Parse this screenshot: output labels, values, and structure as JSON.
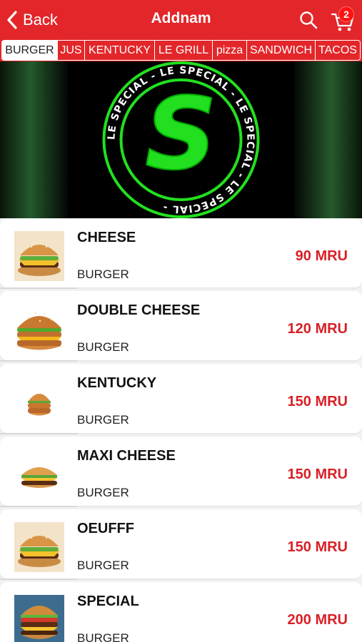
{
  "header": {
    "back_label": "Back",
    "title": "Addnam",
    "cart_count": "2",
    "color": "#e3262a"
  },
  "tabs": [
    {
      "label": "BURGER",
      "active": true
    },
    {
      "label": "JUS",
      "active": false
    },
    {
      "label": "KENTUCKY",
      "active": false
    },
    {
      "label": "LE GRILL",
      "active": false
    },
    {
      "label": "pizza",
      "active": false
    },
    {
      "label": "SANDWICH",
      "active": false
    },
    {
      "label": "TACOS",
      "active": false
    }
  ],
  "banner": {
    "logo_letter": "S",
    "ring_text": "LE SPECIAL - LE SPECIAL - LE SPECIAL - LE SPECIAL - ",
    "logo_color": "#22e01f"
  },
  "items": [
    {
      "name": "CHEESE",
      "category": "BURGER",
      "price": "90 MRU",
      "image": "burger-icon"
    },
    {
      "name": "DOUBLE CHEESE",
      "category": "BURGER",
      "price": "120 MRU",
      "image": "burger-icon"
    },
    {
      "name": "KENTUCKY",
      "category": "BURGER",
      "price": "150 MRU",
      "image": "burger-icon"
    },
    {
      "name": "MAXI CHEESE",
      "category": "BURGER",
      "price": "150 MRU",
      "image": "burger-icon"
    },
    {
      "name": "OEUFFF",
      "category": "BURGER",
      "price": "150 MRU",
      "image": "burger-icon"
    },
    {
      "name": "SPECIAL",
      "category": "BURGER",
      "price": "200 MRU",
      "image": "burger-icon"
    }
  ]
}
